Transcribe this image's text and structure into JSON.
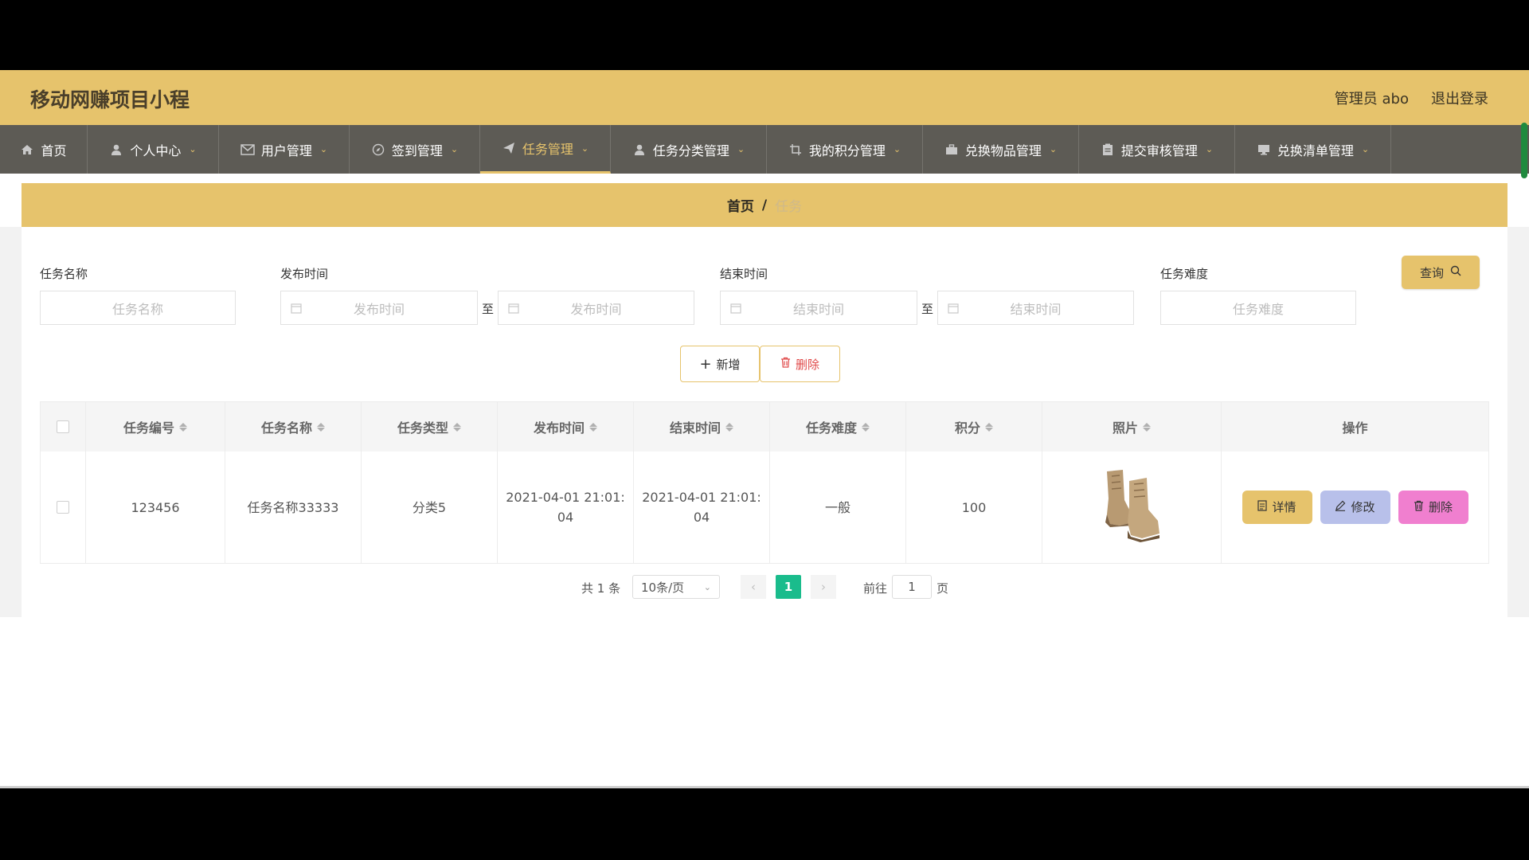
{
  "header": {
    "app_title": "移动网赚项目小程",
    "admin_label": "管理员 abo",
    "logout_label": "退出登录"
  },
  "nav": {
    "items": [
      {
        "label": "首页",
        "icon": "home-icon"
      },
      {
        "label": "个人中心",
        "icon": "user-icon"
      },
      {
        "label": "用户管理",
        "icon": "mail-icon"
      },
      {
        "label": "签到管理",
        "icon": "compass-icon"
      },
      {
        "label": "任务管理",
        "icon": "send-icon",
        "active": true
      },
      {
        "label": "任务分类管理",
        "icon": "user-icon"
      },
      {
        "label": "我的积分管理",
        "icon": "crop-icon"
      },
      {
        "label": "兑换物品管理",
        "icon": "briefcase-icon"
      },
      {
        "label": "提交审核管理",
        "icon": "clipboard-icon"
      },
      {
        "label": "兑换清单管理",
        "icon": "monitor-icon"
      }
    ]
  },
  "breadcrumb": {
    "home": "首页",
    "separator": "/",
    "current": "任务"
  },
  "search": {
    "name_label": "任务名称",
    "name_placeholder": "任务名称",
    "publish_label": "发布时间",
    "publish_start_placeholder": "发布时间",
    "publish_end_placeholder": "发布时间",
    "end_label": "结束时间",
    "end_start_placeholder": "结束时间",
    "end_end_placeholder": "结束时间",
    "range_sep": "至",
    "difficulty_label": "任务难度",
    "difficulty_placeholder": "任务难度",
    "query_button": "查询"
  },
  "actions": {
    "add_label": "新增",
    "delete_label": "删除"
  },
  "table": {
    "columns": [
      "任务编号",
      "任务名称",
      "任务类型",
      "发布时间",
      "结束时间",
      "任务难度",
      "积分",
      "照片",
      "操作"
    ],
    "rows": [
      {
        "id": "123456",
        "name": "任务名称33333",
        "type": "分类5",
        "publish_time": "2021-04-01 21:01:04",
        "end_time": "2021-04-01 21:01:04",
        "difficulty": "一般",
        "points": "100",
        "photo": "boots-image",
        "detail_label": "详情",
        "edit_label": "修改",
        "delete_label": "删除"
      }
    ]
  },
  "pagination": {
    "total_label": "共 1 条",
    "page_size": "10条/页",
    "current_page": "1",
    "goto_label": "前往",
    "goto_value": "1",
    "page_suffix": "页"
  },
  "colors": {
    "accent": "#e6c36c",
    "nav_bg": "#5d5b55",
    "edit_btn": "#b8c0ea",
    "delete_btn": "#f07fcf",
    "page_active": "#1abc8c"
  }
}
